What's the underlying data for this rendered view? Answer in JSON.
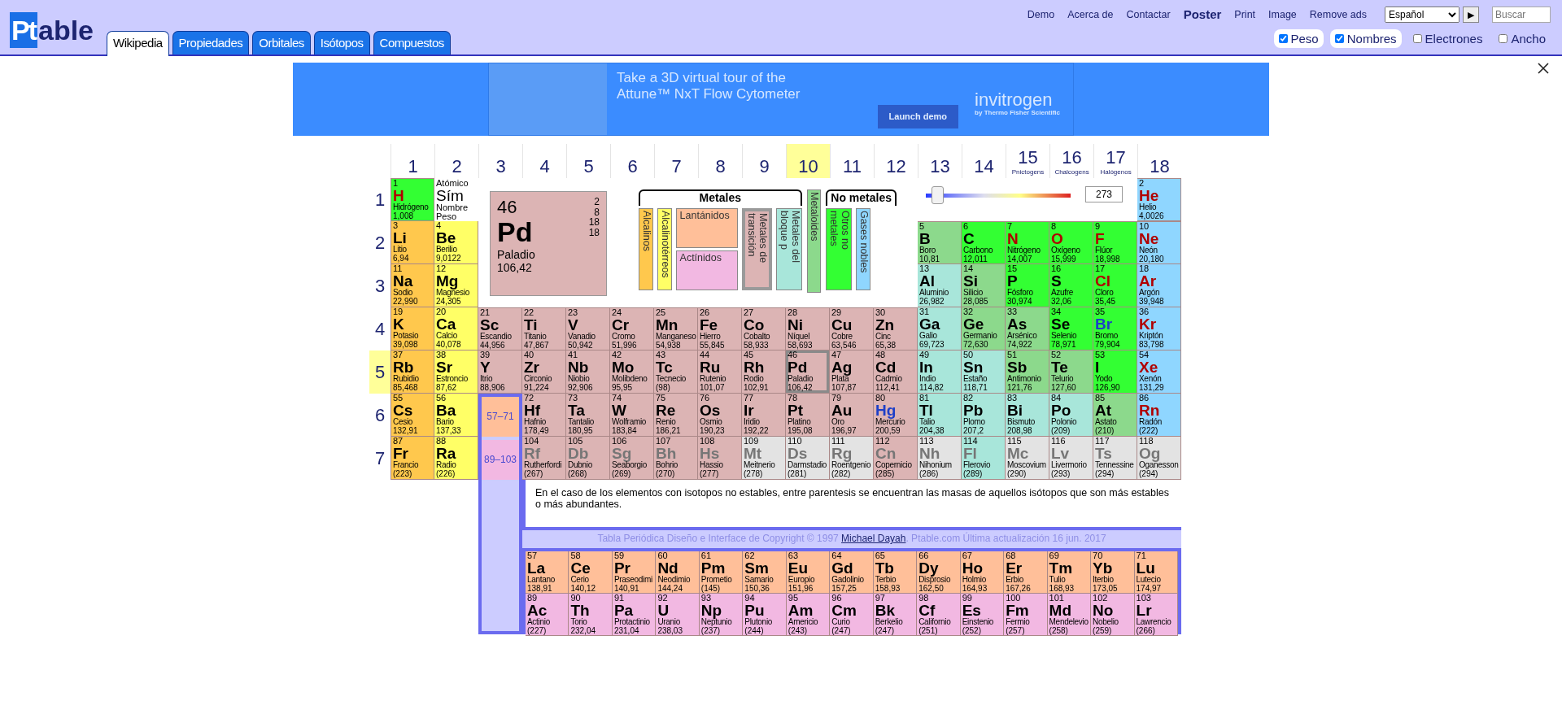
{
  "header": {
    "logo": {
      "mark": "Pt",
      "text": "able"
    },
    "tabs": [
      {
        "label": "Wikipedia",
        "selected": true
      },
      {
        "label": "Propiedades",
        "selected": false
      },
      {
        "label": "Orbitales",
        "selected": false
      },
      {
        "label": "Isótopos",
        "selected": false
      },
      {
        "label": "Compuestos",
        "selected": false
      }
    ],
    "links": [
      {
        "label": "Demo",
        "bold": false
      },
      {
        "label": "Acerca de",
        "bold": false
      },
      {
        "label": "Contactar",
        "bold": false
      },
      {
        "label": "Poster",
        "bold": true
      },
      {
        "label": "Print",
        "bold": false
      },
      {
        "label": "Image",
        "bold": false
      },
      {
        "label": "Remove ads",
        "bold": false
      }
    ],
    "language": "Español",
    "go_button": "▶",
    "search": {
      "placeholder": "Buscar"
    },
    "options": [
      {
        "label": "Peso",
        "checked": true
      },
      {
        "label": "Nombres",
        "checked": true
      },
      {
        "label": "Electrones",
        "checked": false
      },
      {
        "label": "Ancho",
        "checked": false
      }
    ]
  },
  "ad": {
    "headline": "Take a 3D virtual tour of the Attune™ NxT Flow Cytometer",
    "button": "Launch demo",
    "brand": "invitrogen",
    "tagline": "by Thermo Fisher Scientific"
  },
  "table": {
    "groups": [
      {
        "label": "1",
        "selected": false
      },
      {
        "label": "2",
        "selected": false
      },
      {
        "label": "3",
        "selected": false
      },
      {
        "label": "4",
        "selected": false
      },
      {
        "label": "5",
        "selected": false
      },
      {
        "label": "6",
        "selected": false
      },
      {
        "label": "7",
        "selected": false
      },
      {
        "label": "8",
        "selected": false
      },
      {
        "label": "9",
        "selected": false
      },
      {
        "label": "10",
        "selected": true
      },
      {
        "label": "11",
        "selected": false
      },
      {
        "label": "12",
        "selected": false
      },
      {
        "label": "13",
        "selected": false
      },
      {
        "label": "14",
        "selected": false
      },
      {
        "label": "15",
        "subtitle": "Pnictogens",
        "selected": false
      },
      {
        "label": "16",
        "subtitle": "Chalcogens",
        "selected": false
      },
      {
        "label": "17",
        "subtitle": "Halógenos",
        "selected": false
      },
      {
        "label": "18",
        "selected": false
      }
    ],
    "legend_key": {
      "number": "Atómico",
      "symbol": "Sím",
      "name": "Nombre",
      "weight": "Peso"
    },
    "key": {
      "number": "46",
      "symbol": "Pd",
      "name": "Paladio",
      "weight": "106,42",
      "shells": [
        "2",
        "8",
        "18",
        "18"
      ],
      "color": "#dcb4b4"
    },
    "legend": [
      {
        "kind": "bracket",
        "label": "Metales",
        "items": [
          {
            "label": "Alcalinos",
            "kind": "vertical",
            "color": "#ffc84d",
            "selected": false
          },
          {
            "label": "Alcalinotérreos",
            "kind": "vertical",
            "color": "#ffff66",
            "selected": false
          },
          {
            "label": "Lantánidos",
            "kind": "horizontal",
            "color": "#ffbf99",
            "selected": false
          },
          {
            "label": "Actínidos",
            "kind": "horizontal",
            "color": "#f2b8e2",
            "selected": false
          },
          {
            "label": "Metales de transición",
            "kind": "vertical",
            "color": "#dcb4b4",
            "selected": true
          },
          {
            "label": "Metales del bloque p",
            "kind": "vertical",
            "color": "#a8e6da",
            "selected": false
          }
        ]
      },
      {
        "kind": "single",
        "items": [
          {
            "label": "Metaloides",
            "kind": "vertical",
            "color": "#8cd98c",
            "selected": false
          }
        ]
      },
      {
        "kind": "bracket",
        "label": "No metales",
        "items": [
          {
            "label": "Otros no metales",
            "kind": "vertical",
            "color": "#33ff33",
            "selected": false
          },
          {
            "label": "Gases nobles",
            "kind": "vertical",
            "color": "#8fd6ff",
            "selected": false
          }
        ]
      }
    ],
    "temperature": {
      "level": 0.045,
      "value": "273"
    },
    "periods": [
      {
        "label": "1",
        "selected": false,
        "left": [
          {
            "number": "1",
            "symbol": "H",
            "name": "Hidrógeno",
            "weight": "1,008",
            "color": "#33ff33",
            "kind": "gas",
            "selected": false
          }
        ],
        "right": [
          {
            "number": "2",
            "symbol": "He",
            "name": "Helio",
            "weight": "4,0026",
            "color": "#8fd6ff",
            "kind": "gas",
            "selected": false
          }
        ]
      },
      {
        "label": "2",
        "selected": false,
        "left": [
          {
            "number": "3",
            "symbol": "Li",
            "name": "Litio",
            "weight": "6,94",
            "color": "#ffc84d",
            "kind": "solid",
            "selected": false
          },
          {
            "number": "4",
            "symbol": "Be",
            "name": "Berilio",
            "weight": "9,0122",
            "color": "#ffff66",
            "kind": "solid",
            "selected": false
          }
        ],
        "right": [
          {
            "number": "5",
            "symbol": "B",
            "name": "Boro",
            "weight": "10,81",
            "color": "#8cd98c",
            "kind": "solid",
            "selected": false
          },
          {
            "number": "6",
            "symbol": "C",
            "name": "Carbono",
            "weight": "12,011",
            "color": "#33ff33",
            "kind": "solid",
            "selected": false
          },
          {
            "number": "7",
            "symbol": "N",
            "name": "Nitrógeno",
            "weight": "14,007",
            "color": "#33ff33",
            "kind": "gas",
            "selected": false
          },
          {
            "number": "8",
            "symbol": "O",
            "name": "Oxígeno",
            "weight": "15,999",
            "color": "#33ff33",
            "kind": "gas",
            "selected": false
          },
          {
            "number": "9",
            "symbol": "F",
            "name": "Flúor",
            "weight": "18,998",
            "color": "#33ff33",
            "kind": "gas",
            "selected": false
          },
          {
            "number": "10",
            "symbol": "Ne",
            "name": "Neón",
            "weight": "20,180",
            "color": "#8fd6ff",
            "kind": "gas",
            "selected": false
          }
        ]
      },
      {
        "label": "3",
        "selected": false,
        "left": [
          {
            "number": "11",
            "symbol": "Na",
            "name": "Sodio",
            "weight": "22,990",
            "color": "#ffc84d",
            "kind": "solid",
            "selected": false
          },
          {
            "number": "12",
            "symbol": "Mg",
            "name": "Magnesio",
            "weight": "24,305",
            "color": "#ffff66",
            "kind": "solid",
            "selected": false
          }
        ],
        "right": [
          {
            "number": "13",
            "symbol": "Al",
            "name": "Aluminio",
            "weight": "26,982",
            "color": "#a8e6da",
            "kind": "solid",
            "selected": false
          },
          {
            "number": "14",
            "symbol": "Si",
            "name": "Silicio",
            "weight": "28,085",
            "color": "#8cd98c",
            "kind": "solid",
            "selected": false
          },
          {
            "number": "15",
            "symbol": "P",
            "name": "Fósforo",
            "weight": "30,974",
            "color": "#33ff33",
            "kind": "solid",
            "selected": false
          },
          {
            "number": "16",
            "symbol": "S",
            "name": "Azufre",
            "weight": "32,06",
            "color": "#33ff33",
            "kind": "solid",
            "selected": false
          },
          {
            "number": "17",
            "symbol": "Cl",
            "name": "Cloro",
            "weight": "35,45",
            "color": "#33ff33",
            "kind": "gas",
            "selected": false
          },
          {
            "number": "18",
            "symbol": "Ar",
            "name": "Argón",
            "weight": "39,948",
            "color": "#8fd6ff",
            "kind": "gas",
            "selected": false
          }
        ]
      },
      {
        "label": "4",
        "selected": false,
        "left": [
          {
            "number": "19",
            "symbol": "K",
            "name": "Potasio",
            "weight": "39,098",
            "color": "#ffc84d",
            "kind": "solid",
            "selected": false
          },
          {
            "number": "20",
            "symbol": "Ca",
            "name": "Calcio",
            "weight": "40,078",
            "color": "#ffff66",
            "kind": "solid",
            "selected": false
          }
        ],
        "right": [
          {
            "number": "21",
            "symbol": "Sc",
            "name": "Escandio",
            "weight": "44,956",
            "color": "#dcb4b4",
            "kind": "solid",
            "selected": false
          },
          {
            "number": "22",
            "symbol": "Ti",
            "name": "Titanio",
            "weight": "47,867",
            "color": "#dcb4b4",
            "kind": "solid",
            "selected": false
          },
          {
            "number": "23",
            "symbol": "V",
            "name": "Vanadio",
            "weight": "50,942",
            "color": "#dcb4b4",
            "kind": "solid",
            "selected": false
          },
          {
            "number": "24",
            "symbol": "Cr",
            "name": "Cromo",
            "weight": "51,996",
            "color": "#dcb4b4",
            "kind": "solid",
            "selected": false
          },
          {
            "number": "25",
            "symbol": "Mn",
            "name": "Manganeso",
            "weight": "54,938",
            "color": "#dcb4b4",
            "kind": "solid",
            "selected": false
          },
          {
            "number": "26",
            "symbol": "Fe",
            "name": "Hierro",
            "weight": "55,845",
            "color": "#dcb4b4",
            "kind": "solid",
            "selected": false
          },
          {
            "number": "27",
            "symbol": "Co",
            "name": "Cobalto",
            "weight": "58,933",
            "color": "#dcb4b4",
            "kind": "solid",
            "selected": false
          },
          {
            "number": "28",
            "symbol": "Ni",
            "name": "Níquel",
            "weight": "58,693",
            "color": "#dcb4b4",
            "kind": "solid",
            "selected": false
          },
          {
            "number": "29",
            "symbol": "Cu",
            "name": "Cobre",
            "weight": "63,546",
            "color": "#dcb4b4",
            "kind": "solid",
            "selected": false
          },
          {
            "number": "30",
            "symbol": "Zn",
            "name": "Cinc",
            "weight": "65,38",
            "color": "#dcb4b4",
            "kind": "solid",
            "selected": false
          },
          {
            "number": "31",
            "symbol": "Ga",
            "name": "Galio",
            "weight": "69,723",
            "color": "#a8e6da",
            "kind": "solid",
            "selected": false
          },
          {
            "number": "32",
            "symbol": "Ge",
            "name": "Germanio",
            "weight": "72,630",
            "color": "#8cd98c",
            "kind": "solid",
            "selected": false
          },
          {
            "number": "33",
            "symbol": "As",
            "name": "Arsénico",
            "weight": "74,922",
            "color": "#8cd98c",
            "kind": "solid",
            "selected": false
          },
          {
            "number": "34",
            "symbol": "Se",
            "name": "Selenio",
            "weight": "78,971",
            "color": "#33ff33",
            "kind": "solid",
            "selected": false
          },
          {
            "number": "35",
            "symbol": "Br",
            "name": "Bromo",
            "weight": "79,904",
            "color": "#33ff33",
            "kind": "liquid",
            "selected": false
          },
          {
            "number": "36",
            "symbol": "Kr",
            "name": "Kriptón",
            "weight": "83,798",
            "color": "#8fd6ff",
            "kind": "gas",
            "selected": false
          }
        ]
      },
      {
        "label": "5",
        "selected": true,
        "left": [
          {
            "number": "37",
            "symbol": "Rb",
            "name": "Rubidio",
            "weight": "85,468",
            "color": "#ffc84d",
            "kind": "solid",
            "selected": false
          },
          {
            "number": "38",
            "symbol": "Sr",
            "name": "Estroncio",
            "weight": "87,62",
            "color": "#ffff66",
            "kind": "solid",
            "selected": false
          }
        ],
        "right": [
          {
            "number": "39",
            "symbol": "Y",
            "name": "Itrio",
            "weight": "88,906",
            "color": "#dcb4b4",
            "kind": "solid",
            "selected": false
          },
          {
            "number": "40",
            "symbol": "Zr",
            "name": "Circonio",
            "weight": "91,224",
            "color": "#dcb4b4",
            "kind": "solid",
            "selected": false
          },
          {
            "number": "41",
            "symbol": "Nb",
            "name": "Niobio",
            "weight": "92,906",
            "color": "#dcb4b4",
            "kind": "solid",
            "selected": false
          },
          {
            "number": "42",
            "symbol": "Mo",
            "name": "Molibdeno",
            "weight": "95,95",
            "color": "#dcb4b4",
            "kind": "solid",
            "selected": false
          },
          {
            "number": "43",
            "symbol": "Tc",
            "name": "Tecnecio",
            "weight": "(98)",
            "color": "#dcb4b4",
            "kind": "solid",
            "selected": false
          },
          {
            "number": "44",
            "symbol": "Ru",
            "name": "Rutenio",
            "weight": "101,07",
            "color": "#dcb4b4",
            "kind": "solid",
            "selected": false
          },
          {
            "number": "45",
            "symbol": "Rh",
            "name": "Rodio",
            "weight": "102,91",
            "color": "#dcb4b4",
            "kind": "solid",
            "selected": false
          },
          {
            "number": "46",
            "symbol": "Pd",
            "name": "Paladio",
            "weight": "106,42",
            "color": "#dcb4b4",
            "kind": "solid",
            "selected": true
          },
          {
            "number": "47",
            "symbol": "Ag",
            "name": "Plata",
            "weight": "107,87",
            "color": "#dcb4b4",
            "kind": "solid",
            "selected": false
          },
          {
            "number": "48",
            "symbol": "Cd",
            "name": "Cadmio",
            "weight": "112,41",
            "color": "#dcb4b4",
            "kind": "solid",
            "selected": false
          },
          {
            "number": "49",
            "symbol": "In",
            "name": "Indio",
            "weight": "114,82",
            "color": "#a8e6da",
            "kind": "solid",
            "selected": false
          },
          {
            "number": "50",
            "symbol": "Sn",
            "name": "Estaño",
            "weight": "118,71",
            "color": "#a8e6da",
            "kind": "solid",
            "selected": false
          },
          {
            "number": "51",
            "symbol": "Sb",
            "name": "Antimonio",
            "weight": "121,76",
            "color": "#8cd98c",
            "kind": "solid",
            "selected": false
          },
          {
            "number": "52",
            "symbol": "Te",
            "name": "Telurio",
            "weight": "127,60",
            "color": "#8cd98c",
            "kind": "solid",
            "selected": false
          },
          {
            "number": "53",
            "symbol": "I",
            "name": "Yodo",
            "weight": "126,90",
            "color": "#33ff33",
            "kind": "solid",
            "selected": false
          },
          {
            "number": "54",
            "symbol": "Xe",
            "name": "Xenón",
            "weight": "131,29",
            "color": "#8fd6ff",
            "kind": "gas",
            "selected": false
          }
        ]
      },
      {
        "label": "6",
        "selected": false,
        "left": [
          {
            "number": "55",
            "symbol": "Cs",
            "name": "Cesio",
            "weight": "132,91",
            "color": "#ffc84d",
            "kind": "solid",
            "selected": false
          },
          {
            "number": "56",
            "symbol": "Ba",
            "name": "Bario",
            "weight": "137,33",
            "color": "#ffff66",
            "kind": "solid",
            "selected": false
          }
        ],
        "placeholder": {
          "label": "57–71",
          "color": "#ffbf99"
        },
        "right": [
          {
            "number": "72",
            "symbol": "Hf",
            "name": "Hafnio",
            "weight": "178,49",
            "color": "#dcb4b4",
            "kind": "solid",
            "selected": false
          },
          {
            "number": "73",
            "symbol": "Ta",
            "name": "Tantalio",
            "weight": "180,95",
            "color": "#dcb4b4",
            "kind": "solid",
            "selected": false
          },
          {
            "number": "74",
            "symbol": "W",
            "name": "Wolframio",
            "weight": "183,84",
            "color": "#dcb4b4",
            "kind": "solid",
            "selected": false
          },
          {
            "number": "75",
            "symbol": "Re",
            "name": "Renio",
            "weight": "186,21",
            "color": "#dcb4b4",
            "kind": "solid",
            "selected": false
          },
          {
            "number": "76",
            "symbol": "Os",
            "name": "Osmio",
            "weight": "190,23",
            "color": "#dcb4b4",
            "kind": "solid",
            "selected": false
          },
          {
            "number": "77",
            "symbol": "Ir",
            "name": "Iridio",
            "weight": "192,22",
            "color": "#dcb4b4",
            "kind": "solid",
            "selected": false
          },
          {
            "number": "78",
            "symbol": "Pt",
            "name": "Platino",
            "weight": "195,08",
            "color": "#dcb4b4",
            "kind": "solid",
            "selected": false
          },
          {
            "number": "79",
            "symbol": "Au",
            "name": "Oro",
            "weight": "196,97",
            "color": "#dcb4b4",
            "kind": "solid",
            "selected": false
          },
          {
            "number": "80",
            "symbol": "Hg",
            "name": "Mercurio",
            "weight": "200,59",
            "color": "#dcb4b4",
            "kind": "liquid",
            "selected": false
          },
          {
            "number": "81",
            "symbol": "Tl",
            "name": "Talio",
            "weight": "204,38",
            "color": "#a8e6da",
            "kind": "solid",
            "selected": false
          },
          {
            "number": "82",
            "symbol": "Pb",
            "name": "Plomo",
            "weight": "207,2",
            "color": "#a8e6da",
            "kind": "solid",
            "selected": false
          },
          {
            "number": "83",
            "symbol": "Bi",
            "name": "Bismuto",
            "weight": "208,98",
            "color": "#a8e6da",
            "kind": "solid",
            "selected": false
          },
          {
            "number": "84",
            "symbol": "Po",
            "name": "Polonio",
            "weight": "(209)",
            "color": "#a8e6da",
            "kind": "solid",
            "selected": false
          },
          {
            "number": "85",
            "symbol": "At",
            "name": "Astato",
            "weight": "(210)",
            "color": "#8cd98c",
            "kind": "solid",
            "selected": false
          },
          {
            "number": "86",
            "symbol": "Rn",
            "name": "Radón",
            "weight": "(222)",
            "color": "#8fd6ff",
            "kind": "gas",
            "selected": false
          }
        ]
      },
      {
        "label": "7",
        "selected": false,
        "left": [
          {
            "number": "87",
            "symbol": "Fr",
            "name": "Francio",
            "weight": "(223)",
            "color": "#ffc84d",
            "kind": "solid",
            "selected": false
          },
          {
            "number": "88",
            "symbol": "Ra",
            "name": "Radio",
            "weight": "(226)",
            "color": "#ffff66",
            "kind": "solid",
            "selected": false
          }
        ],
        "placeholder": {
          "label": "89–103",
          "color": "#f2b8e2"
        },
        "right": [
          {
            "number": "104",
            "symbol": "Rf",
            "name": "Rutherfordi",
            "weight": "(267)",
            "color": "#dcb4b4",
            "kind": "unknown",
            "selected": false
          },
          {
            "number": "105",
            "symbol": "Db",
            "name": "Dubnio",
            "weight": "(268)",
            "color": "#dcb4b4",
            "kind": "unknown",
            "selected": false
          },
          {
            "number": "106",
            "symbol": "Sg",
            "name": "Seaborgio",
            "weight": "(269)",
            "color": "#dcb4b4",
            "kind": "unknown",
            "selected": false
          },
          {
            "number": "107",
            "symbol": "Bh",
            "name": "Bohrio",
            "weight": "(270)",
            "color": "#dcb4b4",
            "kind": "unknown",
            "selected": false
          },
          {
            "number": "108",
            "symbol": "Hs",
            "name": "Hassio",
            "weight": "(277)",
            "color": "#dcb4b4",
            "kind": "unknown",
            "selected": false
          },
          {
            "number": "109",
            "symbol": "Mt",
            "name": "Meitnerio",
            "weight": "(278)",
            "color": "#e3e3e3",
            "kind": "unknown",
            "selected": false
          },
          {
            "number": "110",
            "symbol": "Ds",
            "name": "Darmstadio",
            "weight": "(281)",
            "color": "#e3e3e3",
            "kind": "unknown",
            "selected": false
          },
          {
            "number": "111",
            "symbol": "Rg",
            "name": "Roentgenio",
            "weight": "(282)",
            "color": "#e3e3e3",
            "kind": "unknown",
            "selected": false
          },
          {
            "number": "112",
            "symbol": "Cn",
            "name": "Copernicio",
            "weight": "(285)",
            "color": "#dcb4b4",
            "kind": "unknown",
            "selected": false
          },
          {
            "number": "113",
            "symbol": "Nh",
            "name": "Nihonium",
            "weight": "(286)",
            "color": "#e3e3e3",
            "kind": "unknown",
            "selected": false
          },
          {
            "number": "114",
            "symbol": "Fl",
            "name": "Flerovio",
            "weight": "(289)",
            "color": "#a8e6da",
            "kind": "unknown",
            "selected": false
          },
          {
            "number": "115",
            "symbol": "Mc",
            "name": "Moscovium",
            "weight": "(290)",
            "color": "#e3e3e3",
            "kind": "unknown",
            "selected": false
          },
          {
            "number": "116",
            "symbol": "Lv",
            "name": "Livermorio",
            "weight": "(293)",
            "color": "#e3e3e3",
            "kind": "unknown",
            "selected": false
          },
          {
            "number": "117",
            "symbol": "Ts",
            "name": "Tennessine",
            "weight": "(294)",
            "color": "#e3e3e3",
            "kind": "unknown",
            "selected": false
          },
          {
            "number": "118",
            "symbol": "Og",
            "name": "Oganesson",
            "weight": "(294)",
            "color": "#e3e3e3",
            "kind": "unknown",
            "selected": false
          }
        ]
      }
    ],
    "note": "En el caso de los elementos con isotopos no estables, entre parentesis se encuentran las masas de aquellos isótopos que son más estables o más abundantes.",
    "copyright": {
      "before": "Tabla Periódica Diseño e Interface de Copyright © 1997 ",
      "link": "Michael Dayah",
      "after": ". Ptable.com Última actualización 16 jun. 2017"
    },
    "series": [
      {
        "elements": [
          {
            "number": "57",
            "symbol": "La",
            "name": "Lantano",
            "weight": "138,91",
            "color": "#ffbf99",
            "kind": "solid",
            "selected": false
          },
          {
            "number": "58",
            "symbol": "Ce",
            "name": "Cerio",
            "weight": "140,12",
            "color": "#ffbf99",
            "kind": "solid",
            "selected": false
          },
          {
            "number": "59",
            "symbol": "Pr",
            "name": "Praseodimi",
            "weight": "140,91",
            "color": "#ffbf99",
            "kind": "solid",
            "selected": false
          },
          {
            "number": "60",
            "symbol": "Nd",
            "name": "Neodimio",
            "weight": "144,24",
            "color": "#ffbf99",
            "kind": "solid",
            "selected": false
          },
          {
            "number": "61",
            "symbol": "Pm",
            "name": "Prometio",
            "weight": "(145)",
            "color": "#ffbf99",
            "kind": "solid",
            "selected": false
          },
          {
            "number": "62",
            "symbol": "Sm",
            "name": "Samario",
            "weight": "150,36",
            "color": "#ffbf99",
            "kind": "solid",
            "selected": false
          },
          {
            "number": "63",
            "symbol": "Eu",
            "name": "Europio",
            "weight": "151,96",
            "color": "#ffbf99",
            "kind": "solid",
            "selected": false
          },
          {
            "number": "64",
            "symbol": "Gd",
            "name": "Gadolinio",
            "weight": "157,25",
            "color": "#ffbf99",
            "kind": "solid",
            "selected": false
          },
          {
            "number": "65",
            "symbol": "Tb",
            "name": "Terbio",
            "weight": "158,93",
            "color": "#ffbf99",
            "kind": "solid",
            "selected": false
          },
          {
            "number": "66",
            "symbol": "Dy",
            "name": "Disprosio",
            "weight": "162,50",
            "color": "#ffbf99",
            "kind": "solid",
            "selected": false
          },
          {
            "number": "67",
            "symbol": "Ho",
            "name": "Holmio",
            "weight": "164,93",
            "color": "#ffbf99",
            "kind": "solid",
            "selected": false
          },
          {
            "number": "68",
            "symbol": "Er",
            "name": "Erbio",
            "weight": "167,26",
            "color": "#ffbf99",
            "kind": "solid",
            "selected": false
          },
          {
            "number": "69",
            "symbol": "Tm",
            "name": "Tulio",
            "weight": "168,93",
            "color": "#ffbf99",
            "kind": "solid",
            "selected": false
          },
          {
            "number": "70",
            "symbol": "Yb",
            "name": "Iterbio",
            "weight": "173,05",
            "color": "#ffbf99",
            "kind": "solid",
            "selected": false
          },
          {
            "number": "71",
            "symbol": "Lu",
            "name": "Lutecio",
            "weight": "174,97",
            "color": "#ffbf99",
            "kind": "solid",
            "selected": false
          }
        ]
      },
      {
        "elements": [
          {
            "number": "89",
            "symbol": "Ac",
            "name": "Actinio",
            "weight": "(227)",
            "color": "#f2b8e2",
            "kind": "solid",
            "selected": false
          },
          {
            "number": "90",
            "symbol": "Th",
            "name": "Torio",
            "weight": "232,04",
            "color": "#f2b8e2",
            "kind": "solid",
            "selected": false
          },
          {
            "number": "91",
            "symbol": "Pa",
            "name": "Protactinio",
            "weight": "231,04",
            "color": "#f2b8e2",
            "kind": "solid",
            "selected": false
          },
          {
            "number": "92",
            "symbol": "U",
            "name": "Uranio",
            "weight": "238,03",
            "color": "#f2b8e2",
            "kind": "solid",
            "selected": false
          },
          {
            "number": "93",
            "symbol": "Np",
            "name": "Neptunio",
            "weight": "(237)",
            "color": "#f2b8e2",
            "kind": "solid",
            "selected": false
          },
          {
            "number": "94",
            "symbol": "Pu",
            "name": "Plutonio",
            "weight": "(244)",
            "color": "#f2b8e2",
            "kind": "solid",
            "selected": false
          },
          {
            "number": "95",
            "symbol": "Am",
            "name": "Americio",
            "weight": "(243)",
            "color": "#f2b8e2",
            "kind": "solid",
            "selected": false
          },
          {
            "number": "96",
            "symbol": "Cm",
            "name": "Curio",
            "weight": "(247)",
            "color": "#f2b8e2",
            "kind": "solid",
            "selected": false
          },
          {
            "number": "97",
            "symbol": "Bk",
            "name": "Berkelio",
            "weight": "(247)",
            "color": "#f2b8e2",
            "kind": "solid",
            "selected": false
          },
          {
            "number": "98",
            "symbol": "Cf",
            "name": "Californio",
            "weight": "(251)",
            "color": "#f2b8e2",
            "kind": "solid",
            "selected": false
          },
          {
            "number": "99",
            "symbol": "Es",
            "name": "Einstenio",
            "weight": "(252)",
            "color": "#f2b8e2",
            "kind": "solid",
            "selected": false
          },
          {
            "number": "100",
            "symbol": "Fm",
            "name": "Fermio",
            "weight": "(257)",
            "color": "#f2b8e2",
            "kind": "solid",
            "selected": false
          },
          {
            "number": "101",
            "symbol": "Md",
            "name": "Mendelevio",
            "weight": "(258)",
            "color": "#f2b8e2",
            "kind": "solid",
            "selected": false
          },
          {
            "number": "102",
            "symbol": "No",
            "name": "Nobelio",
            "weight": "(259)",
            "color": "#f2b8e2",
            "kind": "solid",
            "selected": false
          },
          {
            "number": "103",
            "symbol": "Lr",
            "name": "Lawrencio",
            "weight": "(266)",
            "color": "#f2b8e2",
            "kind": "solid",
            "selected": false
          }
        ]
      }
    ]
  }
}
